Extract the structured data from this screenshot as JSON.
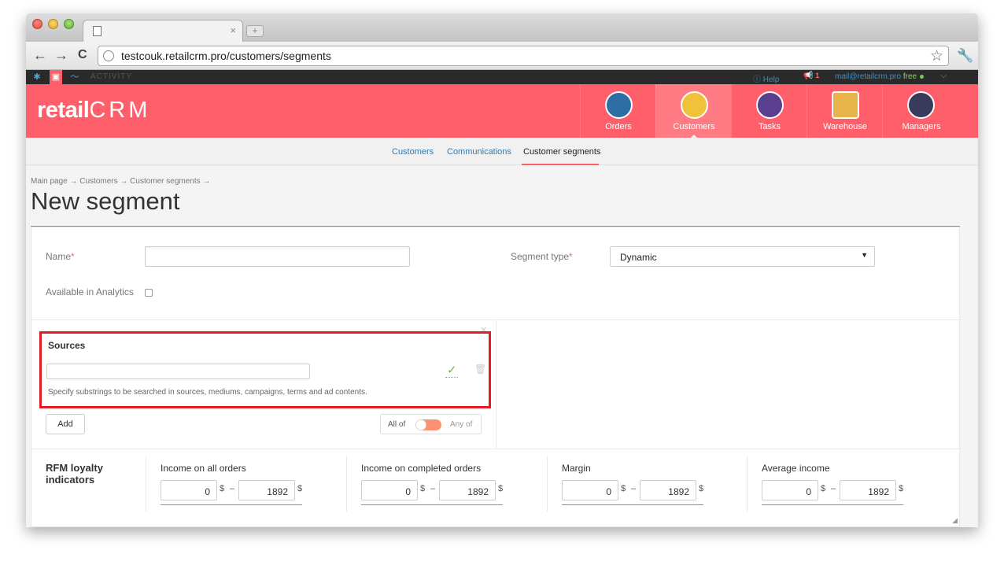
{
  "browser": {
    "new_tab_symbol": "+",
    "tab_close": "×",
    "back": "←",
    "forward": "→",
    "reload": "C",
    "url": "testcouk.retailcrm.pro/customers/segments",
    "star": "☆",
    "wrench": "🔧"
  },
  "topbar": {
    "activity": "ACTIVITY",
    "help": "Help",
    "notification_count": "1",
    "email": "mail@retailcrm.pro",
    "plan": "free",
    "chevron": "⌵"
  },
  "header": {
    "logo_prefix": "retail",
    "logo_suffix": "CRM",
    "nav": [
      {
        "label": "Orders",
        "icon": "cart-icon"
      },
      {
        "label": "Customers",
        "icon": "customer-icon",
        "active": true
      },
      {
        "label": "Tasks",
        "icon": "tasks-icon"
      },
      {
        "label": "Warehouse",
        "icon": "warehouse-icon"
      },
      {
        "label": "Managers",
        "icon": "managers-icon"
      }
    ]
  },
  "subnav": {
    "customers": "Customers",
    "communications": "Communications",
    "segments": "Customer segments"
  },
  "page": {
    "breadcrumb": "Main page → Customers → Customer segments →",
    "title": "New segment"
  },
  "form": {
    "name_label": "Name",
    "required_mark": "*",
    "name_value": "",
    "analytics_label": "Available in Analytics",
    "segment_type_label": "Segment type",
    "segment_type_value": "Dynamic",
    "segment_arrow": "▼"
  },
  "sources": {
    "title": "Sources",
    "value": "",
    "hint": "Specify substrings to be searched in sources, mediums, campaigns, terms and ad contents.",
    "confirm_symbol": "✓",
    "trash_symbol": "🗑",
    "close_symbol": "✕",
    "add_label": "Add",
    "all_of": "All of",
    "any_of": "Any of"
  },
  "rfm": {
    "title": "RFM loyalty indicators",
    "currency": "$",
    "dash": "–",
    "columns": [
      {
        "label": "Income on all orders",
        "min": "0",
        "max": "1892"
      },
      {
        "label": "Income on completed orders",
        "min": "0",
        "max": "1892"
      },
      {
        "label": "Margin",
        "min": "0",
        "max": "1892"
      },
      {
        "label": "Average income",
        "min": "0",
        "max": "1892"
      }
    ]
  },
  "colors": {
    "brand": "#fe5f6a",
    "highlight_border": "#e21b25",
    "link": "#2e7ab3"
  }
}
